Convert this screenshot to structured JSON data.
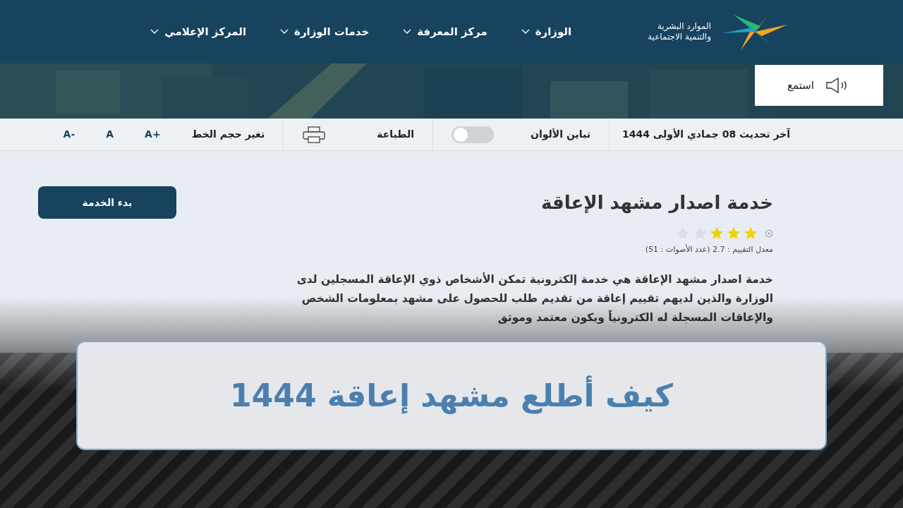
{
  "header": {
    "logo_lines": [
      "الموارد البشرية",
      "والتنمية الاجتماعية"
    ],
    "nav": [
      {
        "label": "الوزارة"
      },
      {
        "label": "مركز المعرفة"
      },
      {
        "label": "خدمات الوزارة"
      },
      {
        "label": "المركز الإعلامي"
      }
    ]
  },
  "listen_button": {
    "label": "استمع"
  },
  "toolbar": {
    "last_update": "آخر تحديث 08 جمادي الأولى 1444",
    "contrast": {
      "label": "تباين الألوان",
      "on": false
    },
    "print": {
      "label": "الطباعة"
    },
    "font_size": {
      "label": "تغير حجم الخط",
      "buttons": [
        "A+",
        "A",
        "A-"
      ]
    }
  },
  "service": {
    "title": "خدمة اصدار مشهد الإعاقة",
    "start_button": "بدء الخدمة",
    "stars": 3,
    "rating_text": "معدل التقييم : 2.7 (عدد الأصوات : 51)",
    "description": "خدمة اصدار مشهد الإعاقة هي خدمة إلكترونية تمكن الأشخاص ذوي الإعاقة المسجلين لدى الوزارة والذين لديهم تقييم إعاقة من تقديم طلب للحصول على مشهد بمعلومات الشخص والإعاقات المسجلة له الكترونياً ويكون معتمد وموثق"
  },
  "banner": {
    "headline": "كيف أطلع مشهد إعاقة 1444"
  }
}
